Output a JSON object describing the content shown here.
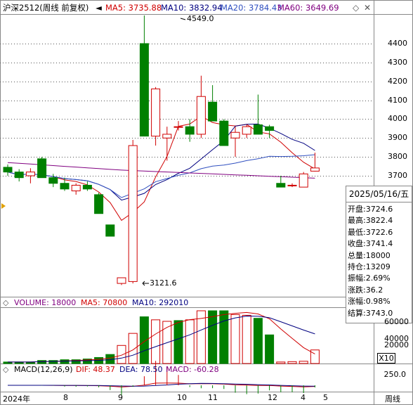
{
  "header": {
    "symbol": "沪深2512(周线 前复权)",
    "ma5_label": "MA5: 3735.88",
    "ma10_label": "MA10: 3832.94",
    "ma20_label": "MA20: 3784.43",
    "ma60_label": "MA60: 3649.69"
  },
  "colors": {
    "up": "#d00000",
    "down": "#008000",
    "ma5": "#d00000",
    "ma10": "#000080",
    "ma20": "#3050c0",
    "ma60": "#800080",
    "grid": "#555555"
  },
  "price_axis": {
    "labels": [
      "4400",
      "4300",
      "4200",
      "4100",
      "4000",
      "3900",
      "3800",
      "3700"
    ]
  },
  "annotations": {
    "high": "4549.0",
    "low": "3121.6"
  },
  "info_panel": {
    "date": "2025/05/16/五",
    "rows": [
      "开盘:3724.6",
      "最高:3822.4",
      "最低:3722.6",
      "收盘:3741.4",
      "总量:18000",
      "持仓:13209",
      "振幅:2.69%",
      "涨跌:36.2",
      "涨幅:0.98%",
      "结算:3743.0"
    ]
  },
  "volume_header": {
    "title": "VOLUME: 18000",
    "ma5": "MA5: 70800",
    "ma10": "MA10: 292010"
  },
  "volume_axis": {
    "labels": [
      "60000",
      "40000",
      "20000",
      "X10"
    ]
  },
  "macd_header": {
    "title": "MACD(12,26,9)",
    "dif": "DIF: 48.37",
    "dea": "DEA: 78.50",
    "macd": "MACD: -60.28"
  },
  "macd_axis": {
    "labels": [
      "250.0"
    ]
  },
  "x_axis": {
    "labels": [
      "2024年",
      "8",
      "9",
      "10",
      "11",
      "12",
      "4",
      "5"
    ],
    "period": "周线"
  },
  "chart_data": {
    "type": "candlestick",
    "ohlc": [
      {
        "o": 3745,
        "h": 3760,
        "l": 3700,
        "c": 3720
      },
      {
        "o": 3720,
        "h": 3735,
        "l": 3670,
        "c": 3690
      },
      {
        "o": 3700,
        "h": 3740,
        "l": 3660,
        "c": 3720
      },
      {
        "o": 3790,
        "h": 3800,
        "l": 3690,
        "c": 3690
      },
      {
        "o": 3690,
        "h": 3710,
        "l": 3640,
        "c": 3660
      },
      {
        "o": 3660,
        "h": 3690,
        "l": 3620,
        "c": 3630
      },
      {
        "o": 3620,
        "h": 3660,
        "l": 3600,
        "c": 3650
      },
      {
        "o": 3650,
        "h": 3670,
        "l": 3620,
        "c": 3630
      },
      {
        "o": 3600,
        "h": 3610,
        "l": 3500,
        "c": 3500
      },
      {
        "o": 3440,
        "h": 3440,
        "l": 3380,
        "c": 3380
      },
      {
        "o": 3130,
        "h": 3160,
        "l": 3121.6,
        "c": 3160
      },
      {
        "o": 3140,
        "h": 3890,
        "l": 3130,
        "c": 3860
      },
      {
        "o": 4400,
        "h": 4549,
        "l": 3910,
        "c": 3910
      },
      {
        "o": 3910,
        "h": 4170,
        "l": 3860,
        "c": 4160
      },
      {
        "o": 3900,
        "h": 3960,
        "l": 3780,
        "c": 3920
      },
      {
        "o": 3960,
        "h": 3990,
        "l": 3940,
        "c": 3960
      },
      {
        "o": 3960,
        "h": 4000,
        "l": 3880,
        "c": 3920
      },
      {
        "o": 3920,
        "h": 4230,
        "l": 3900,
        "c": 4120
      },
      {
        "o": 4090,
        "h": 4180,
        "l": 4030,
        "c": 3990
      },
      {
        "o": 3990,
        "h": 4000,
        "l": 3860,
        "c": 3860
      },
      {
        "o": 3900,
        "h": 3960,
        "l": 3800,
        "c": 3930
      },
      {
        "o": 3920,
        "h": 3970,
        "l": 3900,
        "c": 3960
      },
      {
        "o": 3970,
        "h": 4130,
        "l": 3930,
        "c": 3920
      },
      {
        "o": 3960,
        "h": 3970,
        "l": 3900,
        "c": 3940
      },
      {
        "o": 3660,
        "h": 3700,
        "l": 3640,
        "c": 3640
      },
      {
        "o": 3650,
        "h": 3660,
        "l": 3640,
        "c": 3650
      },
      {
        "o": 3640,
        "h": 3720,
        "l": 3640,
        "c": 3710
      },
      {
        "o": 3724.6,
        "h": 3822.4,
        "l": 3722.6,
        "c": 3741.4
      }
    ],
    "volume_is_up": [
      false,
      false,
      false,
      false,
      false,
      false,
      false,
      false,
      false,
      false,
      true,
      true,
      false,
      true,
      true,
      false,
      true,
      true,
      false,
      false,
      true,
      true,
      false,
      false,
      true,
      true,
      true,
      true
    ],
    "volume": [
      2000,
      2000,
      2000,
      4000,
      4000,
      5000,
      5000,
      6000,
      8000,
      12000,
      24000,
      40000,
      62000,
      58000,
      56000,
      57000,
      58000,
      70000,
      70000,
      70000,
      65000,
      64000,
      60000,
      38000,
      2000,
      2500,
      3000,
      18000
    ]
  }
}
